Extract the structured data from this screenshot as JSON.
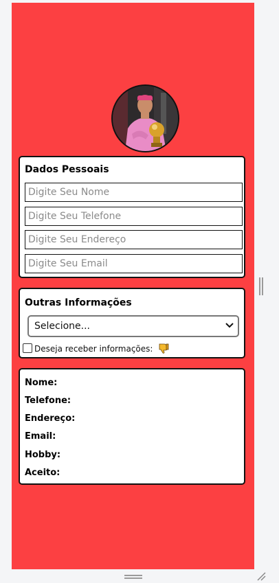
{
  "profile": {
    "avatar_alt": "profile-photo"
  },
  "personal": {
    "title": "Dados Pessoais",
    "name_placeholder": "Digite Seu Nome",
    "phone_placeholder": "Digite Seu Telefone",
    "address_placeholder": "Digite Seu Endereço",
    "email_placeholder": "Digite Seu Email"
  },
  "other": {
    "title": "Outras Informações",
    "select_value": "Selecione...",
    "checkbox_label": "Deseja receber informações:",
    "checkbox_checked": false,
    "emoji_icon": "thumbs-down-icon"
  },
  "summary": {
    "name_label": "Nome:",
    "name_value": "",
    "phone_label": "Telefone:",
    "phone_value": "",
    "address_label": "Endereço:",
    "address_value": "",
    "email_label": "Email:",
    "email_value": "",
    "hobby_label": "Hobby:",
    "hobby_value": "",
    "accept_label": "Aceito:",
    "accept_value": ""
  },
  "colors": {
    "background": "#fc4042",
    "card": "#ffffff",
    "border": "#111111",
    "viewport": "#f4f5f7"
  }
}
